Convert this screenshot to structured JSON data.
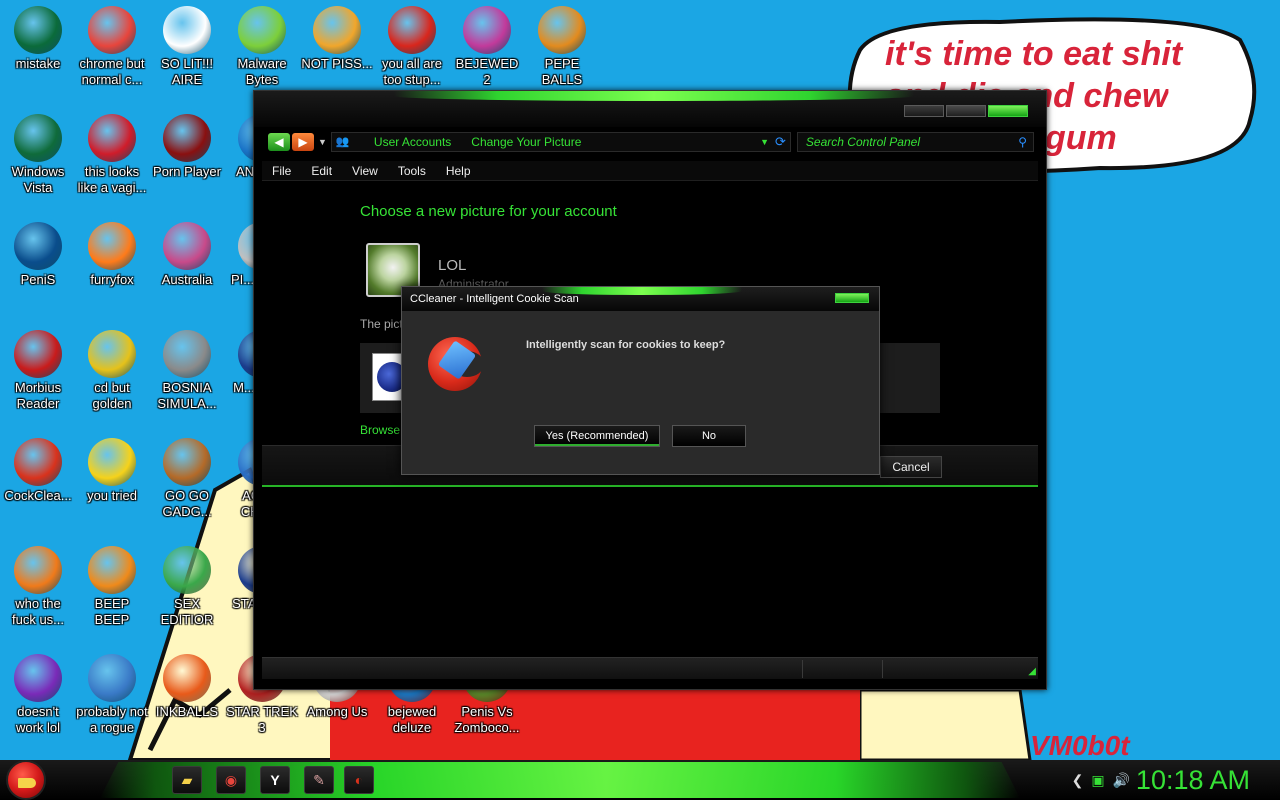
{
  "wallpaper": {
    "bubble_line1": "it's time to eat shit",
    "bubble_line2": "and die and chew",
    "bubble_line3": "gum",
    "tag": "VM0b0t"
  },
  "desktop_icons": [
    {
      "label": "mistake",
      "icon": "vista-orb-icon",
      "color": "#0b6b3a"
    },
    {
      "label": "chrome but normal c...",
      "icon": "chrome-icon",
      "color": "#e8453c"
    },
    {
      "label": "SO LIT!!! AIRE",
      "icon": "solitaire-cards-icon",
      "color": "#ffffff"
    },
    {
      "label": "Malware Bytes",
      "icon": "shield-check-icon",
      "color": "#7dcf3a"
    },
    {
      "label": "NOT PISS...",
      "icon": "angry-birds-pig-icon",
      "color": "#f1a62b"
    },
    {
      "label": "you all are too stup...",
      "icon": "devcpp-icon",
      "color": "#d9261c"
    },
    {
      "label": "BEJEWED 2",
      "icon": "bejeweled-gem-icon",
      "color": "#c23a9b"
    },
    {
      "label": "PEPE BALLS",
      "icon": "pepe-icon",
      "color": "#e38b1e"
    },
    {
      "label": "Windows Vista",
      "icon": "vista-recycle-icon",
      "color": "#0f6b3a"
    },
    {
      "label": "this looks like a vagi...",
      "icon": "opera-icon",
      "color": "#d01c2a"
    },
    {
      "label": "Porn Player",
      "icon": "flash-player-icon",
      "color": "#8a1010"
    },
    {
      "label": "AN... B...",
      "icon": "generic-app-icon",
      "color": "#1a73c7"
    },
    {
      "label": "PeniS",
      "icon": "photoshop-icon",
      "color": "#0a4d8c"
    },
    {
      "label": "furryfox",
      "icon": "firefox-icon",
      "color": "#ff7b1a"
    },
    {
      "label": "Australia",
      "icon": "spider-solitaire-icon",
      "color": "#c84a8a"
    },
    {
      "label": "PI... OFF...",
      "icon": "generic-app-icon",
      "color": "#c0c0c0"
    },
    {
      "label": "Morbius Reader",
      "icon": "adobe-reader-icon",
      "color": "#c91b1b"
    },
    {
      "label": "cd but golden",
      "icon": "golden-cd-icon",
      "color": "#e6c21a"
    },
    {
      "label": "BOSNIA SIMULA...",
      "icon": "minesweeper-icon",
      "color": "#8a8a8a"
    },
    {
      "label": "M... BIR...",
      "icon": "generic-app-icon",
      "color": "#1b3c8c"
    },
    {
      "label": "CockClea...",
      "icon": "ccleaner-icon",
      "color": "#d9321c"
    },
    {
      "label": "you tried",
      "icon": "gold-star-icon",
      "color": "#f6d21a"
    },
    {
      "label": "GO GO GADG...",
      "icon": "briefcase-icon",
      "color": "#b46a28"
    },
    {
      "label": "AGG... CHIC...",
      "icon": "generic-app-icon",
      "color": "#2a6fc7"
    },
    {
      "label": "who the fuck us...",
      "icon": "winamp-bolt-icon",
      "color": "#f07a1a"
    },
    {
      "label": "BEEP BEEP",
      "icon": "vlc-cone-icon",
      "color": "#f08a1a"
    },
    {
      "label": "SEX EDITIOR",
      "icon": "hxd-editor-icon",
      "color": "#3aa84a"
    },
    {
      "label": "STA... G...",
      "icon": "generic-app-icon",
      "color": "#1b3c8c"
    },
    {
      "label": "doesn't work lol",
      "icon": "yahoo-messenger-icon",
      "color": "#7a2ab8"
    },
    {
      "label": "probably not a rogue",
      "icon": "gears-icon",
      "color": "#3a7ac7"
    },
    {
      "label": "INKBALLS",
      "icon": "inkball-icon",
      "color": "#e85a1a"
    },
    {
      "label": "STAR TREK 3",
      "icon": "star-wars-icon",
      "color": "#b32020"
    },
    {
      "label": "Among Us",
      "icon": "among-us-icon",
      "color": "#d8d8d8"
    },
    {
      "label": "bejewed deluze",
      "icon": "bejeweled-deluxe-icon",
      "color": "#1a7ac7"
    },
    {
      "label": "Penis Vs Zomboco...",
      "icon": "pvz-icon",
      "color": "#5a8a2a"
    }
  ],
  "control_panel": {
    "crumbs": [
      "User Accounts",
      "Change Your Picture"
    ],
    "search_placeholder": "Search Control Panel",
    "menu": [
      "File",
      "Edit",
      "View",
      "Tools",
      "Help"
    ],
    "heading": "Choose a new picture for your account",
    "account_name": "LOL",
    "account_role": "Administrator",
    "paragraph": "The pict",
    "browse_link": "Browse",
    "cancel": "Cancel"
  },
  "dialog": {
    "title": "CCleaner - Intelligent Cookie Scan",
    "question": "Intelligently scan for cookies to keep?",
    "yes": "Yes (Recommended)",
    "no": "No"
  },
  "taskbar": {
    "items": [
      "folder-icon",
      "chrome-icon",
      "yandex-icon",
      "paint-icon",
      "ccleaner-icon"
    ],
    "clock": "10:18 AM",
    "accent": "#36e236"
  }
}
